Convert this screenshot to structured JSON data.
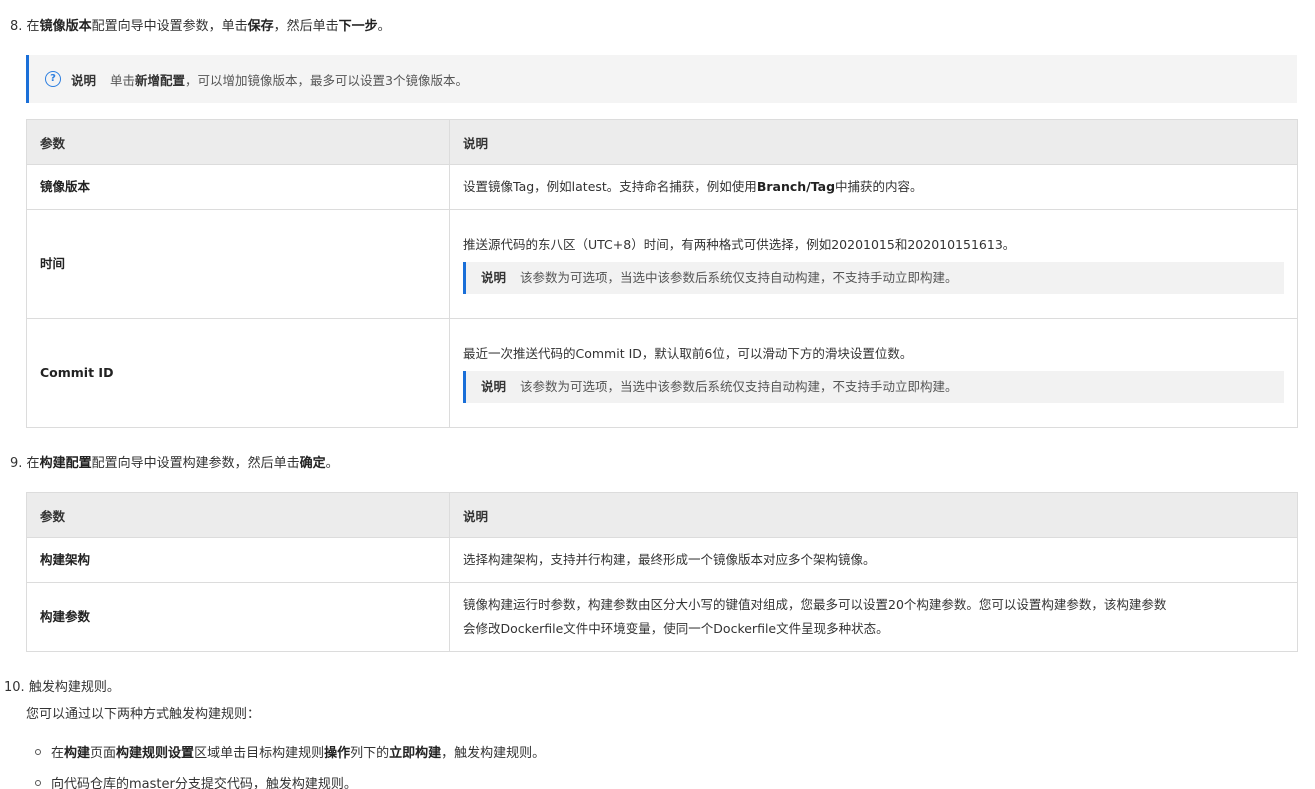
{
  "step8": {
    "num": "8.",
    "t1": "在",
    "b1": "镜像版本",
    "t2": "配置向导中设置参数，单击",
    "b2": "保存",
    "t3": "，然后单击",
    "b3": "下一步",
    "t4": "。"
  },
  "note1": {
    "label": "说明",
    "t1": "单击",
    "b1": "新增配置",
    "t2": "，可以增加镜像版本，最多可以设置3个镜像版本。"
  },
  "table1": {
    "headers": [
      "参数",
      "说明"
    ],
    "rows": [
      {
        "key": "镜像版本",
        "desc_pre": "设置镜像Tag，例如latest。支持命名捕获，例如使用",
        "desc_bold": "Branch/Tag",
        "desc_post": "中捕获的内容。"
      },
      {
        "key": "时间",
        "desc": "推送源代码的东八区（UTC+8）时间，有两种格式可供选择，例如20201015和202010151613。",
        "note_label": "说明",
        "note_text": "该参数为可选项，当选中该参数后系统仅支持自动构建，不支持手动立即构建。"
      },
      {
        "key": "Commit ID",
        "desc": "最近一次推送代码的Commit ID，默认取前6位，可以滑动下方的滑块设置位数。",
        "note_label": "说明",
        "note_text": "该参数为可选项，当选中该参数后系统仅支持自动构建，不支持手动立即构建。"
      }
    ]
  },
  "step9": {
    "num": "9.",
    "t1": "在",
    "b1": "构建配置",
    "t2": "配置向导中设置构建参数，然后单击",
    "b2": "确定",
    "t3": "。"
  },
  "table2": {
    "headers": [
      "参数",
      "说明"
    ],
    "rows": [
      {
        "key": "构建架构",
        "desc": "选择构建架构，支持并行构建，最终形成一个镜像版本对应多个架构镜像。"
      },
      {
        "key": "构建参数",
        "desc_line1": "镜像构建运行时参数，构建参数由区分大小写的键值对组成，您最多可以设置20个构建参数。您可以设置构建参数，该构建参数",
        "desc_line2": "会修改Dockerfile文件中环境变量，使同一个Dockerfile文件呈现多种状态。"
      }
    ]
  },
  "step10": {
    "num": "10.",
    "text": "触发构建规则。",
    "sub": "您可以通过以下两种方式触发构建规则："
  },
  "bullets": {
    "b1": {
      "t1": "在",
      "b1": "构建",
      "t2": "页面",
      "b2": "构建规则设置",
      "t3": "区域单击目标构建规则",
      "b3": "操作",
      "t4": "列下的",
      "b4": "立即构建",
      "t5": "，触发构建规则。"
    },
    "b2": {
      "text": "向代码仓库的master分支提交代码，触发构建规则。"
    }
  },
  "colors": {
    "accent": "#1a6fd8",
    "note_bg": "#f4f4f4",
    "header_bg": "#ececec",
    "border": "#dcdcdc"
  }
}
